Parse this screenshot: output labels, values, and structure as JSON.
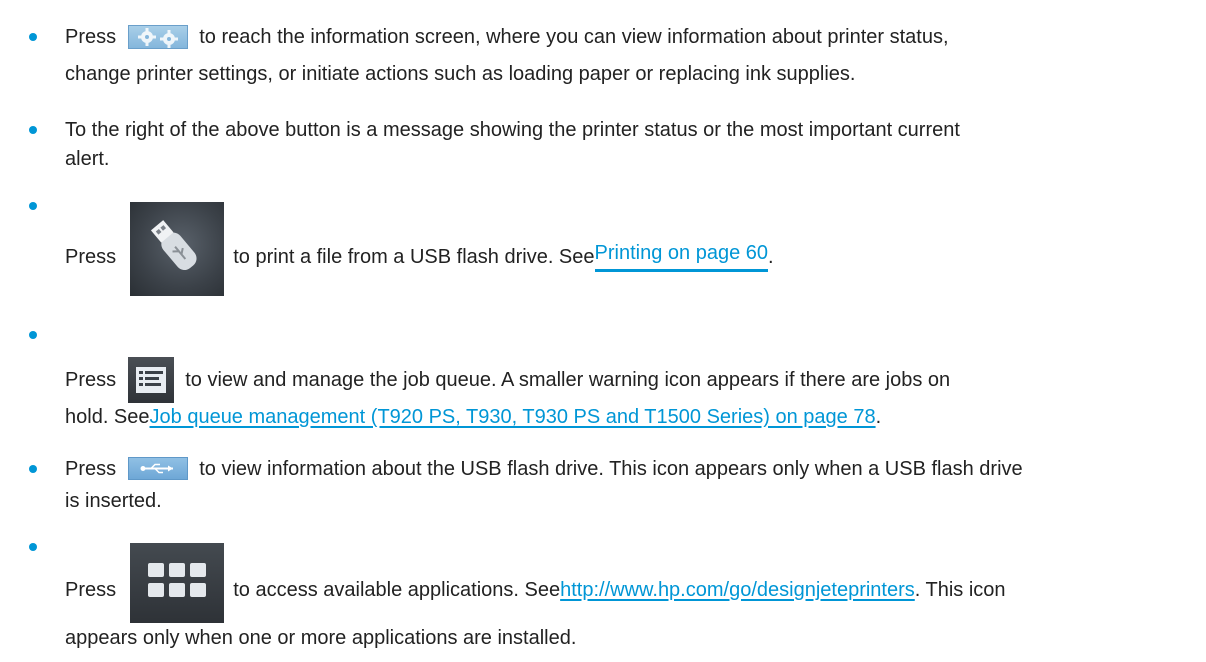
{
  "items": [
    {
      "lines": [
        {
          "before": "Press",
          "after": "to reach the information screen, where you can view information about printer status,"
        },
        {
          "text": "change printer settings, or initiate actions such as loading paper or replacing ink supplies."
        }
      ],
      "icon": "gear-icon"
    },
    {
      "lines": [
        {
          "text": "To the right of the above button is a message showing the printer status or the most important current"
        },
        {
          "text": "alert."
        }
      ]
    },
    {
      "lines": [
        {
          "before": "Press",
          "after": "to print a file from a USB flash drive. See ",
          "link": "Printing on page 60",
          "end": "."
        }
      ],
      "icon": "usb-flash-drive-icon"
    },
    {
      "lines": [
        {
          "before": "Press",
          "after": "to view and manage the job queue. A smaller warning icon appears if there are jobs on"
        },
        {
          "text": "hold. See ",
          "link": "Job queue management (T920 PS, T930, T930 PS and T1500 Series) on page 78",
          "end": "."
        }
      ],
      "icon": "job-queue-icon"
    },
    {
      "lines": [
        {
          "before": "Press",
          "after": "to view information about the USB flash drive. This icon appears only when a USB flash drive"
        },
        {
          "text": "is inserted."
        }
      ],
      "icon": "usb-icon"
    },
    {
      "lines": [
        {
          "before": "Press",
          "after": "to access available applications. See ",
          "link": "http://www.hp.com/go/designjeteprinters",
          "end": ". This icon"
        },
        {
          "text": "appears only when one or more applications are installed."
        }
      ],
      "icon": "applications-icon"
    }
  ],
  "colors": {
    "bullet": "#0096d6",
    "link": "#0096d6",
    "text": "#222222"
  }
}
